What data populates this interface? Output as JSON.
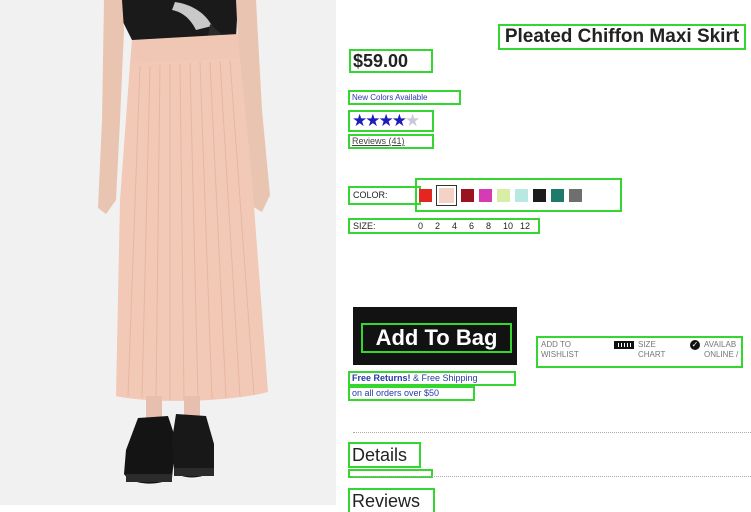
{
  "product": {
    "title": "Pleated Chiffon Maxi Skirt",
    "price": "$59.00",
    "new_colors": "New Colors Available",
    "rating": {
      "filled": "★★★★",
      "faded": "★",
      "value_stars": 4,
      "out_of": 5
    },
    "reviews_link": "Reviews (41)"
  },
  "options": {
    "color_label": "COLOR:",
    "colors": [
      "#e3261f",
      "#f4d3c6",
      "#9b1220",
      "#d63bb4",
      "#d8eea6",
      "#b7e8e1",
      "#1c1c1c",
      "#1f7a6c",
      "#6f6f6f"
    ],
    "selected_color_index": 1,
    "size_label": "SIZE:",
    "sizes": [
      "0",
      "2",
      "4",
      "6",
      "8",
      "10",
      "12"
    ]
  },
  "cart": {
    "add_to_bag": "Add To Bag",
    "wishlist": [
      "ADD TO",
      "WISHLIST"
    ],
    "size_chart": [
      "SIZE",
      "CHART"
    ],
    "availability": [
      "AVAILAB",
      "ONLINE /"
    ]
  },
  "shipping": {
    "free_returns": "Free Returns!",
    "free_shipping": " & Free Shipping",
    "orders_over": "on all orders over $50"
  },
  "sections": {
    "details": "Details",
    "reviews": "Reviews"
  },
  "icons": {
    "wishlist": "wishlist-icon",
    "size_chart": "ruler-icon",
    "availability": "check-circle-icon",
    "star": "star-icon"
  }
}
